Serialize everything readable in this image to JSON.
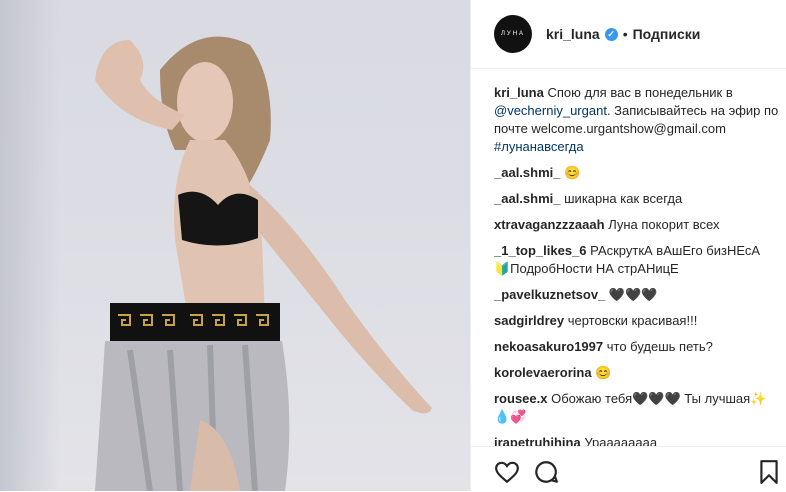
{
  "post": {
    "username": "kri_luna",
    "avatar_text": "ЛУНА",
    "separator": "•",
    "follow_label": "Подписки",
    "caption": {
      "user": "kri_luna",
      "text_before": "Спою для вас в понедельник в",
      "mention": "@vecherniy_urgant",
      "text_after": ". Записывайтесь на эфир по почте",
      "email": "welcome.urgantshow@gmail.com",
      "hashtag": "#лунанавсегда"
    },
    "comments": [
      {
        "user": "_aal.shmi_",
        "text": "😊"
      },
      {
        "user": "_aal.shmi_",
        "text": "шикарна как всегда"
      },
      {
        "user": "xtravaganzzzaaah",
        "text": "Луна покорит всех"
      },
      {
        "user": "_1_top_likes_6",
        "text": "РАскруткА вАшЕго бизНЕсА 🔰ПодробНости НА стрАНицЕ"
      },
      {
        "user": "_pavelkuznetsov_",
        "text": "🖤🖤🖤"
      },
      {
        "user": "sadgirldrey",
        "text": "чертовски красивая!!!"
      },
      {
        "user": "nekoasakuro1997",
        "text": "что будешь петь?"
      },
      {
        "user": "korolevaerorina",
        "text": "😊"
      },
      {
        "user": "rousee.x",
        "text": "Обожаю тебя🖤🖤🖤 Ты лучшая✨💧💞"
      },
      {
        "user": "irapetruhihina",
        "text": "Ураааааааа"
      }
    ]
  },
  "colors": {
    "link": "#003569",
    "verified": "#3897f0",
    "text": "#262626"
  },
  "icons": [
    "heart-icon",
    "comment-icon",
    "bookmark-icon",
    "verified-icon"
  ]
}
